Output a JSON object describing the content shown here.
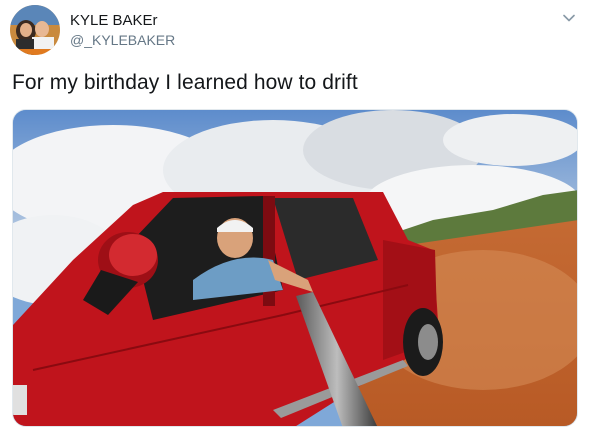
{
  "author": {
    "display_name": "KYLE BAKEr",
    "handle": "@_KYLEBAKER",
    "avatar_icon": "profile-photo"
  },
  "menu": {
    "icon": "chevron-down-icon"
  },
  "tweet": {
    "text": "For my birthday I learned how to drift"
  },
  "media": {
    "type": "video",
    "description_icon": "video-frame"
  },
  "colors": {
    "text": "#14171a",
    "secondary": "#657786",
    "border": "#e1e8ed",
    "truck_red": "#c0141c"
  }
}
